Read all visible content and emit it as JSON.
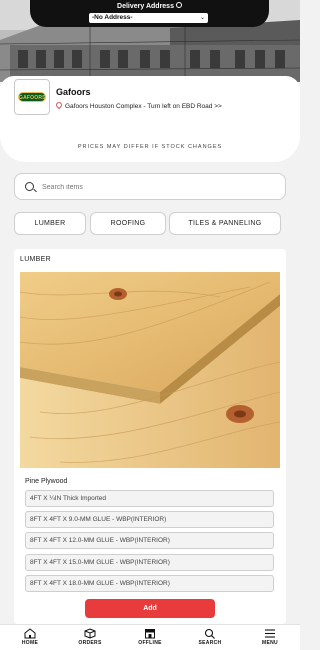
{
  "header": {
    "delivery_title": "Delivery Address",
    "address_value": "-No Address-"
  },
  "store": {
    "logo_text": "GAFOORS",
    "name": "Gafoors",
    "address": "Gafoors Houston Complex - Turn left on EBD Road >>",
    "price_note": "PRICES MAY DIFFER IF STOCK CHANGES"
  },
  "search": {
    "placeholder": "Search items"
  },
  "categories": [
    {
      "label": "LUMBER"
    },
    {
      "label": "ROOFING"
    },
    {
      "label": "TILES & PANNELING"
    }
  ],
  "product_section": {
    "title": "LUMBER",
    "product_name": "Pine Plywood",
    "variants": [
      "4FT X ¼IN Thick Imported",
      "8FT X 4FT X 9.0-MM GLUE - WBP(INTERIOR)",
      "8FT X 4FT X 12.0-MM GLUE - WBP(INTERIOR)",
      "8FT X 4FT X 15.0-MM GLUE - WBP(INTERIOR)",
      "8FT X 4FT X 18.0-MM GLUE - WBP(INTERIOR)"
    ],
    "add_label": "Add"
  },
  "nav": [
    {
      "label": "HOME",
      "icon": "home-icon"
    },
    {
      "label": "ORDERS",
      "icon": "box-icon"
    },
    {
      "label": "OFFLINE",
      "icon": "offline-store-icon"
    },
    {
      "label": "SEARCH",
      "icon": "search-icon"
    },
    {
      "label": "MENU",
      "icon": "menu-icon"
    }
  ],
  "colors": {
    "accent_red": "#e83b3b",
    "logo_green": "#0b5a1e",
    "logo_gold": "#e8c14a"
  }
}
